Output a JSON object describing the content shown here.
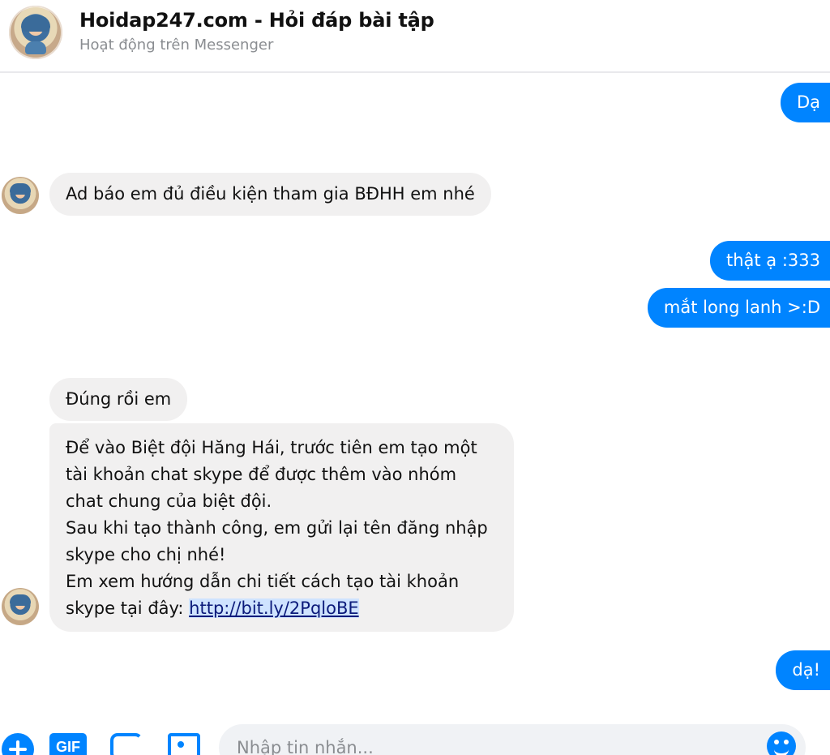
{
  "header": {
    "title": "Hoidap247.com - Hỏi đáp bài tập",
    "subtitle": "Hoạt động trên Messenger"
  },
  "messages": [
    {
      "direction": "outgoing",
      "text": "Dạ"
    },
    {
      "direction": "incoming",
      "text": "Ad báo em đủ điều kiện tham gia BĐHH em nhé"
    },
    {
      "direction": "outgoing",
      "text": "thật ạ :333"
    },
    {
      "direction": "outgoing",
      "text": "mắt long lanh >:D"
    },
    {
      "direction": "incoming",
      "text": "Đúng rồi em"
    },
    {
      "direction": "incoming",
      "lines": [
        "Để vào Biệt đội Hăng Hái, trước tiên em tạo một",
        "tài khoản chat skype để được thêm vào nhóm",
        "chat chung của biệt đội.",
        "Sau khi tạo thành công, em gửi lại tên đăng nhập",
        "skype cho chị nhé!",
        "Em xem hướng dẫn chi tiết cách tạo tài khoản",
        "skype tại đây: "
      ],
      "link": "http://bit.ly/2PqloBE"
    },
    {
      "direction": "outgoing",
      "text": "dạ!"
    }
  ],
  "composer": {
    "placeholder": "Nhập tin nhắn...",
    "gif_label": "GIF",
    "icons": [
      "plus-icon",
      "gif-icon",
      "sticker-icon",
      "image-icon",
      "emoji-icon"
    ]
  },
  "colors": {
    "accent": "#0084ff",
    "incoming_bubble": "#f1f0f0",
    "header_border": "#e9e9ec"
  }
}
